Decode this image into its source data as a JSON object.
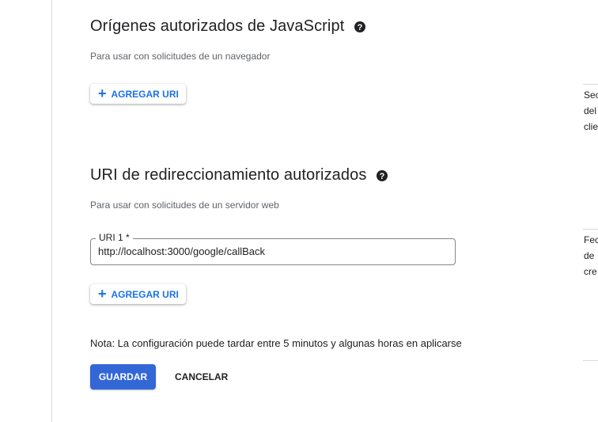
{
  "js_origins": {
    "title": "Orígenes autorizados de JavaScript",
    "subtitle": "Para usar con solicitudes de un navegador",
    "add_label": "AGREGAR URI"
  },
  "redirect_uris": {
    "title": "URI de redireccionamiento autorizados",
    "subtitle": "Para usar con solicitudes de un servidor web",
    "field_label": "URI 1 *",
    "field_value": "http://localhost:3000/google/callBack",
    "add_label": "AGREGAR URI"
  },
  "note": "Nota: La configuración puede tardar entre 5 minutos y algunas horas en aplicarse",
  "actions": {
    "save": "GUARDAR",
    "cancel": "CANCELAR"
  },
  "side_panel": {
    "block1": [
      "Sec",
      "del",
      "clie"
    ],
    "block2": [
      "Fec",
      "de",
      "cre"
    ]
  },
  "colors": {
    "accent": "#1a73e8",
    "primary_button": "#3367d6"
  }
}
